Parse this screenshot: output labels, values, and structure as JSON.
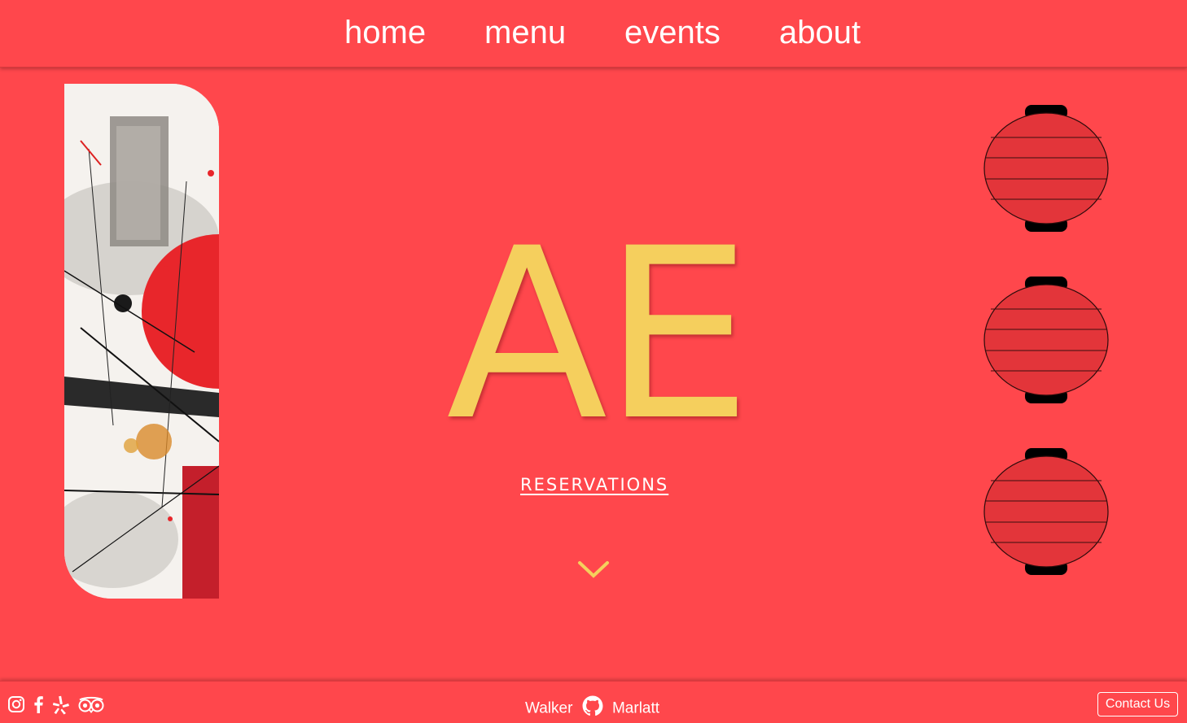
{
  "nav": {
    "items": [
      {
        "label": "home"
      },
      {
        "label": "menu"
      },
      {
        "label": "events"
      },
      {
        "label": "about"
      }
    ]
  },
  "hero": {
    "logo_text": "AE",
    "reservations_label": "RESERVATIONS",
    "scroll_icon": "chevron-down-icon",
    "art_image": "abstract-ink-painting"
  },
  "decor": {
    "lanterns": [
      "red-paper-lantern",
      "red-paper-lantern",
      "red-paper-lantern"
    ]
  },
  "footer": {
    "social_icons": [
      "instagram-icon",
      "facebook-icon",
      "yelp-icon",
      "tripadvisor-icon"
    ],
    "credit_first": "Walker",
    "credit_icon": "github-icon",
    "credit_last": "Marlatt",
    "contact_label": "Contact Us"
  },
  "colors": {
    "background": "#ff474c",
    "accent": "#f5cf5d",
    "lantern": "#e3353a"
  }
}
